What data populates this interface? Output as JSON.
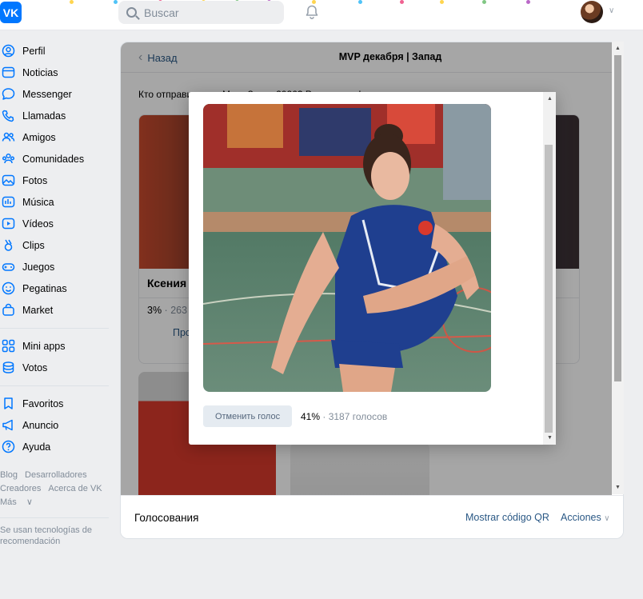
{
  "app": {
    "logo": "VK"
  },
  "header": {
    "search_placeholder": "Buscar",
    "bell_icon": "bell-icon",
    "avatar_icon": "user-avatar",
    "chevron_icon": "chevron-down-icon"
  },
  "sidebar": {
    "items": [
      {
        "label": "Perfil",
        "icon": "user-circle-icon"
      },
      {
        "label": "Noticias",
        "icon": "newspaper-icon"
      },
      {
        "label": "Messenger",
        "icon": "chat-bubble-icon"
      },
      {
        "label": "Llamadas",
        "icon": "phone-icon"
      },
      {
        "label": "Amigos",
        "icon": "friends-icon"
      },
      {
        "label": "Comunidades",
        "icon": "communities-icon"
      },
      {
        "label": "Fotos",
        "icon": "photo-icon"
      },
      {
        "label": "Música",
        "icon": "music-icon"
      },
      {
        "label": "Vídeos",
        "icon": "video-icon"
      },
      {
        "label": "Clips",
        "icon": "clips-icon"
      },
      {
        "label": "Juegos",
        "icon": "gamepad-icon"
      },
      {
        "label": "Pegatinas",
        "icon": "sticker-icon"
      },
      {
        "label": "Market",
        "icon": "shopping-bag-icon"
      }
    ],
    "items2": [
      {
        "label": "Mini apps",
        "icon": "grid-icon"
      },
      {
        "label": "Votos",
        "icon": "coins-icon"
      }
    ],
    "items3": [
      {
        "label": "Favoritos",
        "icon": "bookmark-icon"
      },
      {
        "label": "Anuncio",
        "icon": "megaphone-icon"
      },
      {
        "label": "Ayuda",
        "icon": "question-icon"
      }
    ],
    "footer": {
      "blog": "Blog",
      "developers": "Desarrolladores",
      "creators": "Creadores",
      "about": "Acerca de VK",
      "more": "Más",
      "recommendations": "Se usan tecnologías de recomendación"
    }
  },
  "post": {
    "back_label": "Назад",
    "title": "MVP декабря | Запад",
    "question": "Кто отправится на Матч Звезд 2026? Решать вам!",
    "candidates": [
      {
        "name": "Ксения",
        "percent": "3%",
        "votes": "263",
        "button": "Про"
      }
    ],
    "footer_title": "Голосования",
    "qr_link": "Mostrar código QR",
    "actions_link": "Acciones"
  },
  "modal": {
    "cancel_button": "Отменить голос",
    "percent": "41%",
    "votes": "3187 голосов",
    "separator": " · "
  },
  "colors": {
    "vk_blue": "#0077ff",
    "link": "#2a5885",
    "muted": "#818c99",
    "background": "#edeef0"
  }
}
